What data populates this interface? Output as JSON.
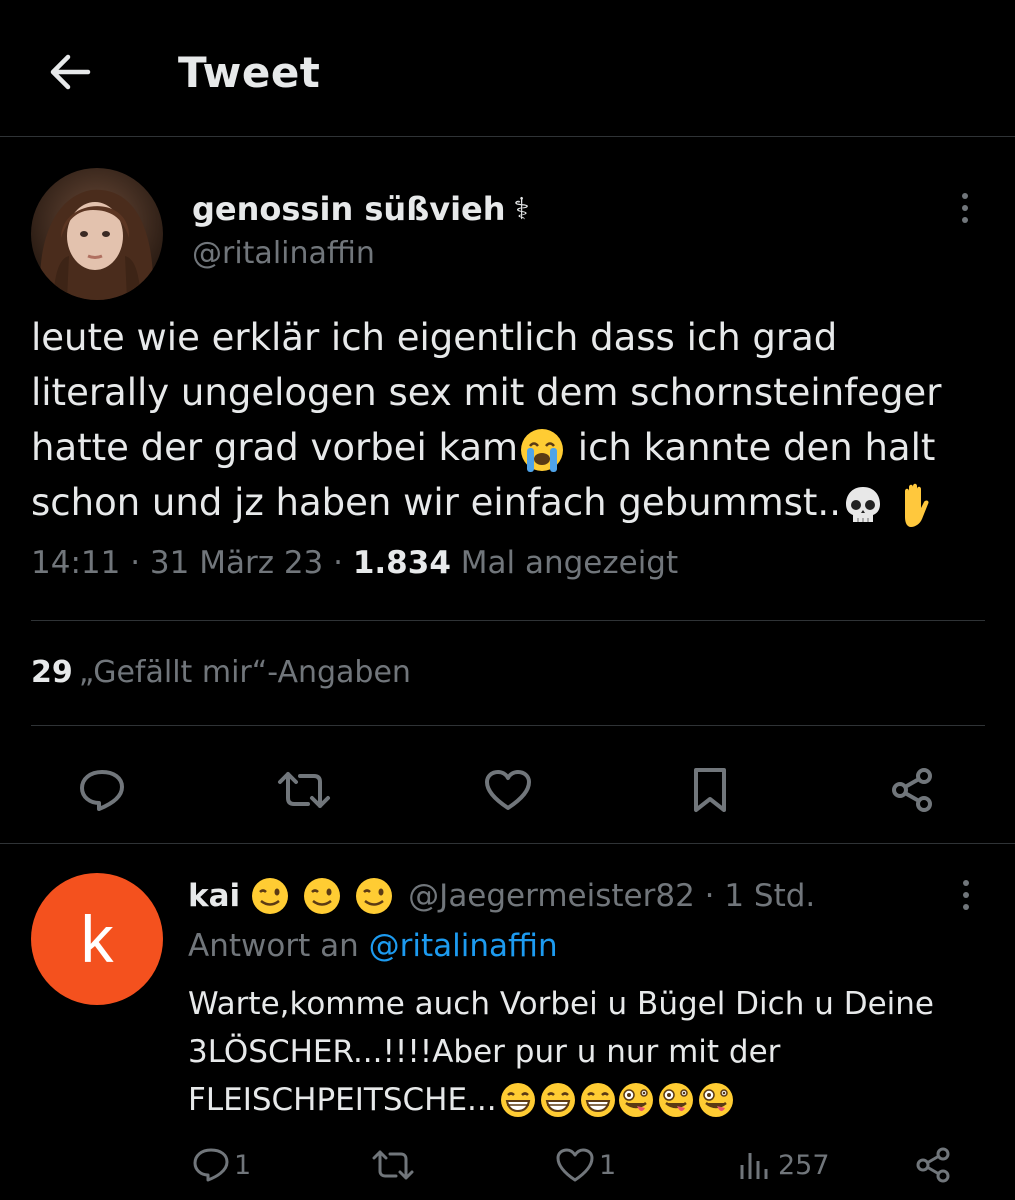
{
  "header": {
    "title": "Tweet"
  },
  "tweet": {
    "author_name": "genossin süßvieh",
    "author_badge": "⚕",
    "author_handle": "@ritalinaffin",
    "text_line1": "leute wie erklär ich eigentlich dass ich grad",
    "text_line2": "literally ungelogen sex mit dem schornsteinfeger",
    "text_line3a": "hatte der grad vorbei kam",
    "text_line3b": " ich kannte den halt",
    "text_line4": "schon und jz haben wir einfach gebummst..",
    "time": "14:11 · 31 März 23 · ",
    "views": "1.834",
    "views_label": " Mal angezeigt",
    "likes_count": "29",
    "likes_label": "„Gefällt mir“-Angaben"
  },
  "reply": {
    "avatar_letter": "k",
    "author_name": "kai",
    "author_handle": "@Jaegermeister82 · 1 Std.",
    "reply_to_label": "Antwort an ",
    "reply_to_handle": "@ritalinaffin",
    "text_line1": "Warte,komme auch Vorbei u Bügel Dich u Deine",
    "text_line2": "3LÖSCHER...!!!!Aber pur u nur mit der",
    "text_line3": "FLEISCHPEITSCHE...",
    "reply_count": "1",
    "like_count": "1",
    "view_count": "257"
  },
  "colors": {
    "background": "#000000",
    "text": "#e7e9ea",
    "muted": "#71767b",
    "link": "#1d9bf0",
    "divider": "#2f3336",
    "reply_avatar": "#f4511e"
  },
  "icons": [
    "back-arrow-icon",
    "more-icon",
    "reply-icon",
    "retweet-icon",
    "like-icon",
    "bookmark-icon",
    "share-icon",
    "views-icon"
  ]
}
